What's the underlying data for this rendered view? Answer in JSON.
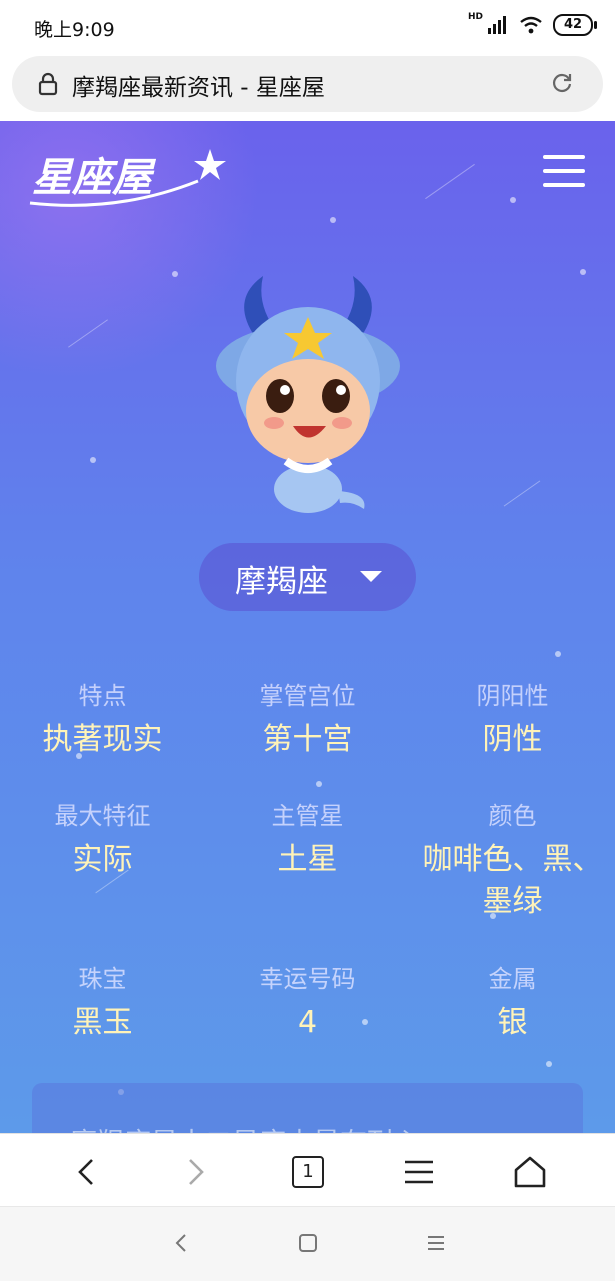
{
  "status": {
    "time": "晚上9:09",
    "network": "HD",
    "battery": "42"
  },
  "address": {
    "title": "摩羯座最新资讯 - 星座屋"
  },
  "site": {
    "logo_text": "星座屋"
  },
  "sign": {
    "name": "摩羯座"
  },
  "attributes": [
    {
      "label": "特点",
      "value": "执著现实"
    },
    {
      "label": "掌管宫位",
      "value": "第十宫"
    },
    {
      "label": "阴阳性",
      "value": "阴性"
    },
    {
      "label": "最大特征",
      "value": "实际"
    },
    {
      "label": "主管星",
      "value": "土星"
    },
    {
      "label": "颜色",
      "value": "咖啡色、黑、墨绿"
    },
    {
      "label": "珠宝",
      "value": "黑玉"
    },
    {
      "label": "幸运号码",
      "value": "4"
    },
    {
      "label": "金属",
      "value": "银"
    }
  ],
  "description": {
    "text": "摩羯座是十二星座中最有耐心"
  },
  "toolbar": {
    "tab_count": "1"
  },
  "colors": {
    "hero_top": "#6a62ec",
    "hero_bottom": "#5d9aea",
    "value_text": "#fff3b8"
  }
}
